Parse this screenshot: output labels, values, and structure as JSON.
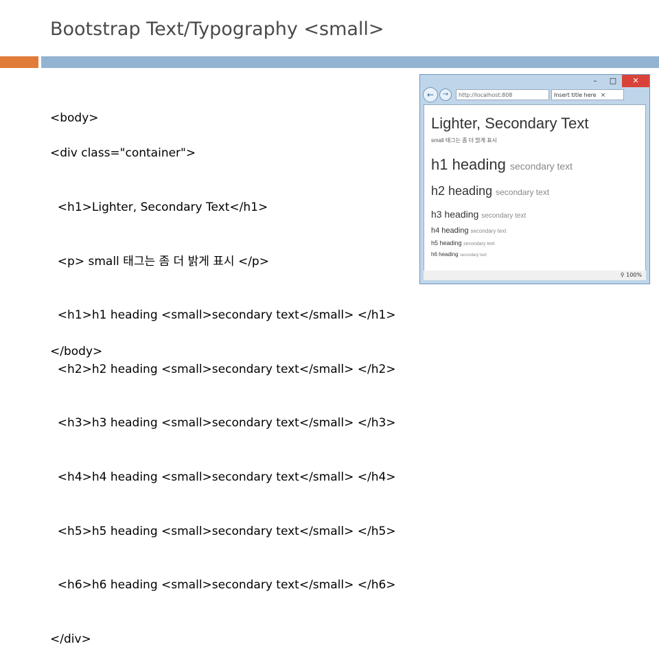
{
  "slide": {
    "title": "Bootstrap Text/Typography <small>"
  },
  "code": {
    "body_open": "<body>",
    "lines": [
      "<div class=\"container\">",
      "  <h1>Lighter, Secondary Text</h1>",
      "  <p> small 태그는 좀 더 밝게 표시 </p>",
      "  <h1>h1 heading <small>secondary text</small> </h1>",
      "  <h2>h2 heading <small>secondary text</small> </h2>",
      "  <h3>h3 heading <small>secondary text</small> </h3>",
      "  <h4>h4 heading <small>secondary text</small> </h4>",
      "  <h5>h5 heading <small>secondary text</small> </h5>",
      "  <h6>h6 heading <small>secondary text</small> </h6>",
      "</div>"
    ],
    "body_close": "</body>"
  },
  "browser": {
    "address": "http://localhost:808",
    "tab_title": "Insert title here",
    "zoom": "100%",
    "page": {
      "h1_title": "Lighter, Secondary Text",
      "paragraph": "small 태그는 좀 더 밝게 표시",
      "headings": [
        {
          "level": "h1",
          "main": "h1 heading",
          "small": "secondary text"
        },
        {
          "level": "h2",
          "main": "h2 heading",
          "small": "secondary text"
        },
        {
          "level": "h3",
          "main": "h3 heading",
          "small": "secondary text"
        },
        {
          "level": "h4",
          "main": "h4 heading",
          "small": "secondary text"
        },
        {
          "level": "h5",
          "main": "h5 heading",
          "small": "secondary text"
        },
        {
          "level": "h6",
          "main": "h6 heading",
          "small": "secondary text"
        }
      ]
    }
  },
  "colors": {
    "accent_orange": "#e07b39",
    "accent_blue": "#93b3d3"
  }
}
